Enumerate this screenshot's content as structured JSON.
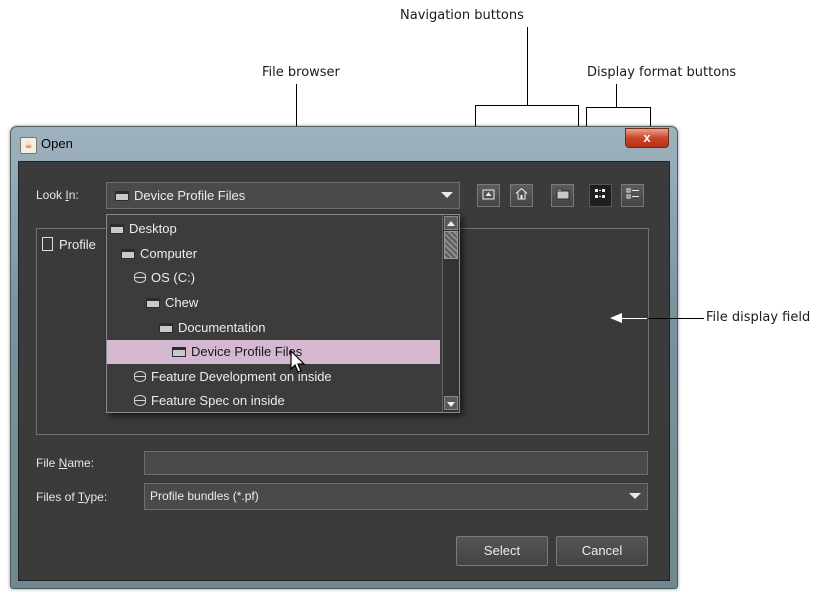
{
  "callouts": {
    "navigation": "Navigation buttons",
    "file_browser": "File browser",
    "display_format": "Display format buttons",
    "file_display": "File display field"
  },
  "window": {
    "title": "Open",
    "close_label": "x"
  },
  "look_in": {
    "label_pre": "Look ",
    "label_key": "I",
    "label_post": "n:",
    "value": "Device Profile Files"
  },
  "dropdown": {
    "items": [
      {
        "label": "Desktop",
        "icon": "folder-icon"
      },
      {
        "label": "Computer",
        "icon": "folder-icon"
      },
      {
        "label": "OS (C:)",
        "icon": "drive-icon"
      },
      {
        "label": "Chew",
        "icon": "folder-icon"
      },
      {
        "label": "Documentation",
        "icon": "folder-icon"
      },
      {
        "label": "Device Profile Files",
        "icon": "folder-icon",
        "selected": true
      },
      {
        "label": "Feature Development on inside",
        "icon": "drive-icon"
      },
      {
        "label": "Feature Spec on inside",
        "icon": "drive-icon"
      }
    ]
  },
  "file_list": {
    "items": [
      "Profile"
    ]
  },
  "file_name": {
    "label_pre": "File ",
    "label_key": "N",
    "label_post": "ame:",
    "value": ""
  },
  "files_of_type": {
    "label_pre": "Files of ",
    "label_key": "T",
    "label_post": "ype:",
    "value": "Profile bundles (*.pf)"
  },
  "buttons": {
    "select": "Select",
    "cancel": "Cancel"
  }
}
